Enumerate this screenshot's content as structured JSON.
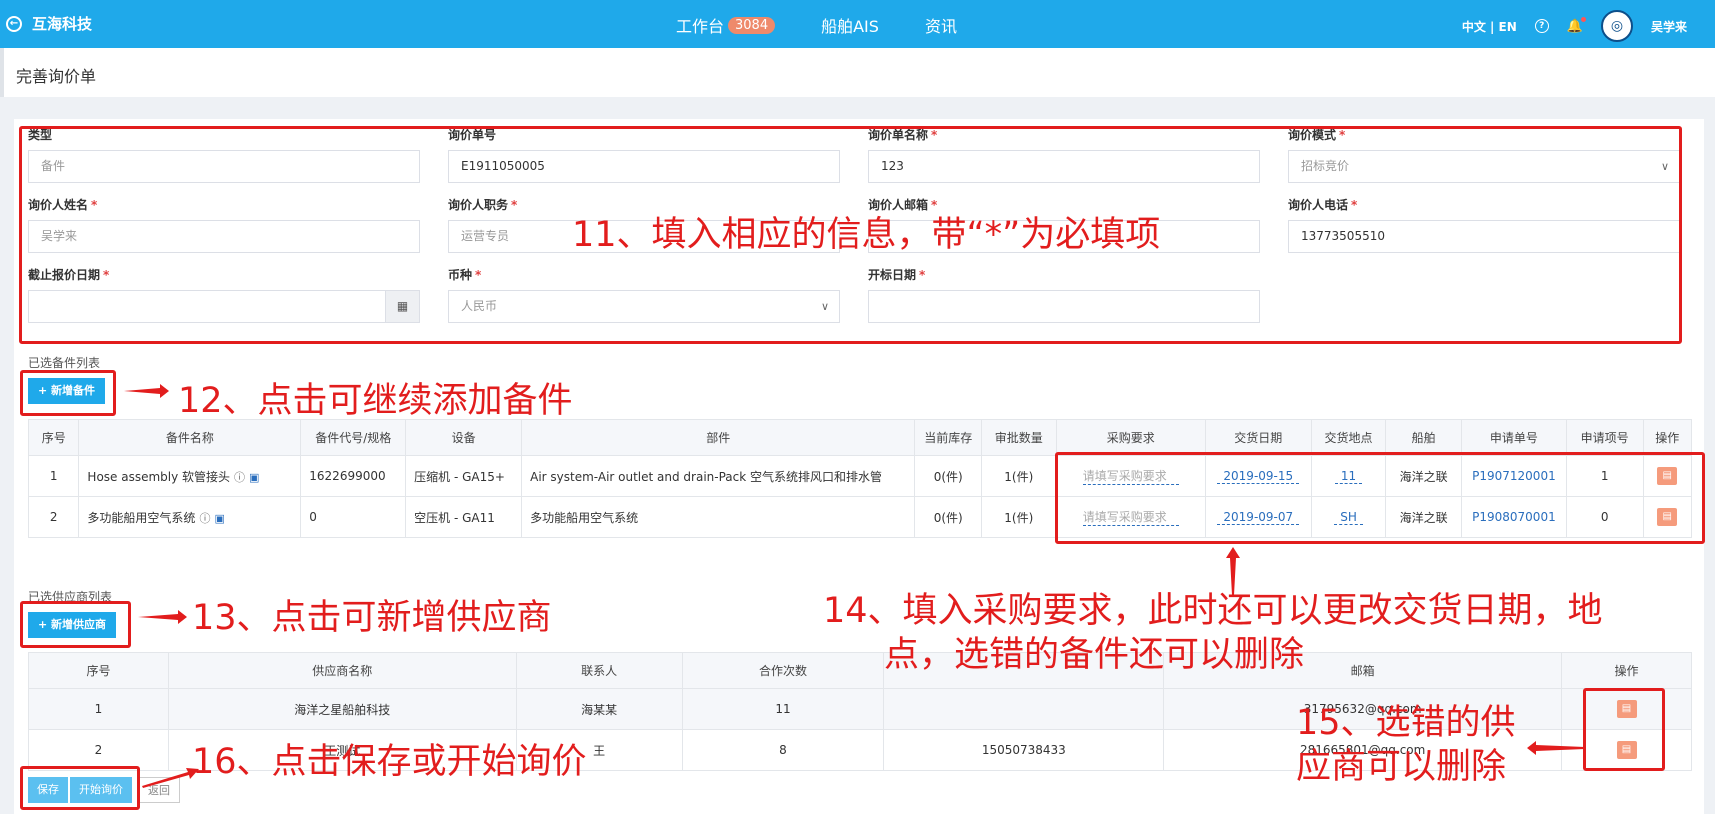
{
  "header": {
    "brand": "互海科技",
    "nav": [
      {
        "label": "工作台",
        "badge": "3084"
      },
      {
        "label": "船舶AIS"
      },
      {
        "label": "资讯"
      }
    ],
    "lang": "中文 | EN",
    "user": "吴学来"
  },
  "page_title": "完善询价单",
  "form": {
    "type": {
      "label": "类型",
      "value": "备件"
    },
    "order_no": {
      "label": "询价单号",
      "value": "E1911050005"
    },
    "order_name": {
      "label": "询价单名称",
      "value": "123"
    },
    "mode": {
      "label": "询价模式",
      "value": "招标竞价"
    },
    "person_name": {
      "label": "询价人姓名",
      "value": "吴学来"
    },
    "person_title": {
      "label": "询价人职务",
      "value": "运营专员"
    },
    "person_email": {
      "label": "询价人邮箱",
      "value": ""
    },
    "person_phone": {
      "label": "询价人电话",
      "value": "13773505510"
    },
    "deadline": {
      "label": "截止报价日期",
      "value": ""
    },
    "currency": {
      "label": "币种",
      "value": "人民币"
    },
    "open_date": {
      "label": "开标日期",
      "value": ""
    }
  },
  "parts_section": {
    "title": "已选备件列表",
    "add_button": "新增备件",
    "columns": [
      "序号",
      "备件名称",
      "备件代号/规格",
      "设备",
      "部件",
      "当前库存",
      "审批数量",
      "采购要求",
      "交货日期",
      "交货地点",
      "船舶",
      "申请单号",
      "申请项号",
      "操作"
    ],
    "rows": [
      {
        "no": "1",
        "name": "Hose assembly 软管接头",
        "code": "1622699000",
        "equipment": "压缩机 - GA15+",
        "component": "Air system-Air outlet and drain-Pack 空气系统排风口和排水管",
        "stock": "0(件)",
        "approved": "1(件)",
        "requirement": "请填写采购要求",
        "delivery_date": "2019-09-15",
        "place": "11",
        "ship": "海洋之联",
        "apply_no": "P1907120001",
        "apply_item": "1"
      },
      {
        "no": "2",
        "name": "多功能船用空气系统",
        "code": "0",
        "equipment": "空压机 - GA11",
        "component": "多功能船用空气系统",
        "stock": "0(件)",
        "approved": "1(件)",
        "requirement": "请填写采购要求",
        "delivery_date": "2019-09-07",
        "place": "SH",
        "ship": "海洋之联",
        "apply_no": "P1908070001",
        "apply_item": "0"
      }
    ]
  },
  "supplier_section": {
    "title": "已选供应商列表",
    "add_button": "新增供应商",
    "columns": [
      "序号",
      "供应商名称",
      "联系人",
      "合作次数",
      "",
      "邮箱",
      "操作"
    ],
    "rows": [
      {
        "no": "1",
        "name": "海洋之星船舶科技",
        "contact": "海某某",
        "times": "11",
        "phone": "",
        "email": "31795632@qq.com"
      },
      {
        "no": "2",
        "name": "王测试",
        "contact": "王",
        "times": "8",
        "phone": "15050738433",
        "email": "281665801@qq.com"
      }
    ]
  },
  "footer": {
    "save": "保存",
    "start": "开始询价",
    "back": "返回"
  },
  "annotations": {
    "a11": "11、填入相应的信息，带“*”为必填项",
    "a12": "12、点击可继续添加备件",
    "a13": "13、点击可新增供应商",
    "a14_line1": "14、填入采购要求，此时还可以更改交货日期，地",
    "a14_line2": "点，选错的备件还可以删除",
    "a15_line1": "15、选错的供",
    "a15_line2": "应商可以删除",
    "a16": "16、点击保存或开始询价"
  },
  "colors": {
    "header": "#1fa9ea",
    "annotation": "#e21d1d",
    "delete": "#f59b7c"
  }
}
